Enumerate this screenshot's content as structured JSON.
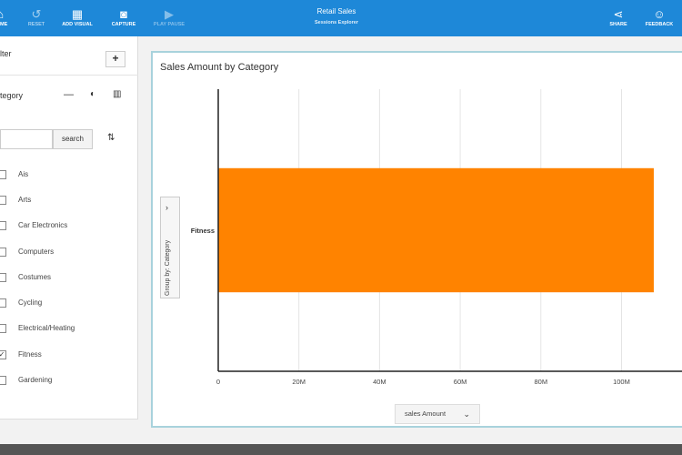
{
  "toolbar": {
    "buttons": [
      {
        "label": "Home",
        "icon": "home-icon",
        "glyph": "⌂"
      },
      {
        "label": "Reset",
        "icon": "reset-icon",
        "glyph": "↺"
      },
      {
        "label": "Add Visual",
        "icon": "add-visual-icon",
        "glyph": "▦"
      },
      {
        "label": "Capture",
        "icon": "camera-icon",
        "glyph": "◙"
      },
      {
        "label": "Play Pause",
        "icon": "play-icon",
        "glyph": "▶"
      }
    ],
    "title": "Retail Sales",
    "subtitle": "Sessions Explorer",
    "right_buttons": [
      {
        "label": "Share",
        "icon": "share-icon",
        "glyph": "⋖"
      },
      {
        "label": "Feedback",
        "icon": "feedback-icon",
        "glyph": "☺"
      }
    ],
    "accent": "#1e88d8"
  },
  "filter": {
    "title": "lter",
    "add_glyph": "+",
    "field": "tegory",
    "search_placeholder": "",
    "search_button": "search",
    "items": [
      {
        "label": "Ais",
        "checked": false
      },
      {
        "label": "Arts",
        "checked": false
      },
      {
        "label": "Car Electronics",
        "checked": false
      },
      {
        "label": "Computers",
        "checked": false
      },
      {
        "label": "Costumes",
        "checked": false
      },
      {
        "label": "Cycling",
        "checked": false
      },
      {
        "label": "Electrical/Heating",
        "checked": false
      },
      {
        "label": "Fitness",
        "checked": true
      },
      {
        "label": "Gardening",
        "checked": false
      }
    ]
  },
  "panel": {
    "title": "Sales Amount by Category",
    "group_tab_label": "Group by: Category",
    "x_dropdown": "sales Amount",
    "border_color": "#a8d2dc"
  },
  "chart_data": {
    "type": "bar",
    "orientation": "horizontal",
    "title": "Sales Amount by Category",
    "categories": [
      "Fitness"
    ],
    "values": [
      108000000
    ],
    "xlim": [
      0,
      115000000
    ],
    "xticks": [
      0,
      20000000,
      40000000,
      60000000,
      80000000,
      100000000
    ],
    "xtick_labels": [
      "0",
      "20M",
      "40M",
      "60M",
      "80M",
      "100M"
    ],
    "xlabel": "sales Amount",
    "ylabel": "Group by: Category",
    "grid": true,
    "bar_color": "#ff8300"
  }
}
